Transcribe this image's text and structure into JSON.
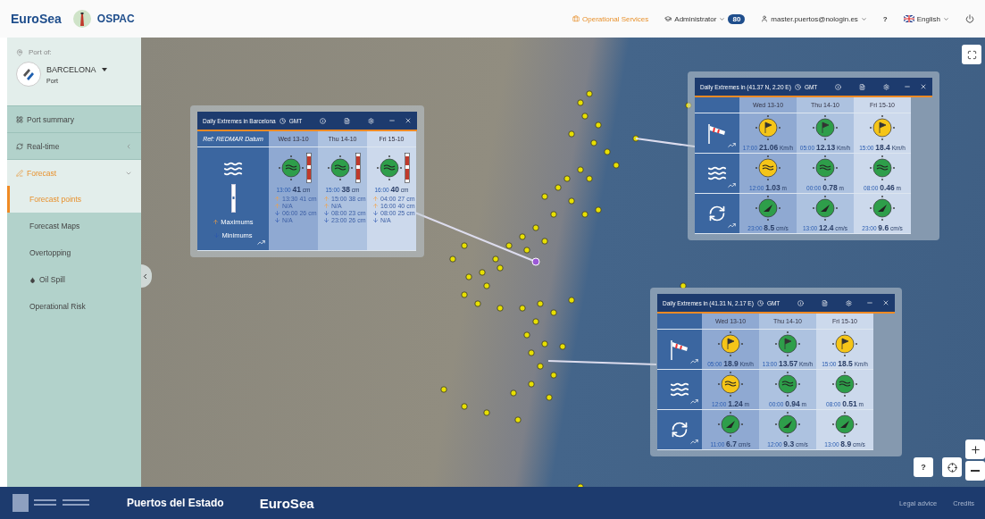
{
  "header": {
    "brand": "EuroSea",
    "logo_title": "OSPAC",
    "nav": [
      {
        "kind": "services",
        "label": "Operational Services"
      },
      {
        "kind": "role",
        "label": "Administrator",
        "badge": "80"
      },
      {
        "kind": "account",
        "label": "master.puertos@nologin.es"
      },
      {
        "kind": "help",
        "label": "?"
      },
      {
        "kind": "language",
        "label": "English"
      },
      {
        "kind": "logout"
      }
    ]
  },
  "sidebar": {
    "port_label": "Port of:",
    "port_name": "BARCELONA",
    "port_type": "Port",
    "items": [
      {
        "kind": "link",
        "label": "Port summary",
        "selected": false
      },
      {
        "kind": "group",
        "label": "Real-time",
        "selected": false,
        "expanded": false
      },
      {
        "kind": "group",
        "label": "Forecast",
        "selected": true,
        "expanded": true,
        "children": [
          {
            "label": "Forecast points",
            "selected": true
          },
          {
            "label": "Forecast Maps",
            "selected": false
          },
          {
            "label": "Overtopping",
            "selected": false
          },
          {
            "label": "Oil Spill",
            "selected": false
          },
          {
            "label": "Operational Risk",
            "selected": false
          }
        ]
      }
    ]
  },
  "map": {
    "help_label": "?"
  },
  "popups": [
    {
      "title": "Daily Extremes in Barcelona",
      "timezone": "GMT",
      "ref": "Ref: REDMAR Datum",
      "days": [
        "Wed 13-10",
        "Thu 14-10",
        "Fri 15-10"
      ],
      "rows": [
        {
          "kind": "sea_level",
          "legend": [
            "Maximums",
            "Minimums"
          ],
          "cells": [
            {
              "time": "13:00",
              "value": "41",
              "unit": "cm",
              "color": "#2e9e4a",
              "extremes": [
                {
                  "kind": "max",
                  "text": "13:30 41 cm"
                },
                {
                  "kind": "max",
                  "text": "N/A"
                },
                {
                  "kind": "min",
                  "text": "06:00 26 cm"
                },
                {
                  "kind": "min",
                  "text": "N/A"
                }
              ]
            },
            {
              "time": "15:00",
              "value": "38",
              "unit": "cm",
              "color": "#2e9e4a",
              "extremes": [
                {
                  "kind": "max",
                  "text": "15:00 38 cm"
                },
                {
                  "kind": "max",
                  "text": "N/A"
                },
                {
                  "kind": "min",
                  "text": "08:00 23 cm"
                },
                {
                  "kind": "min",
                  "text": "23:00 26 cm"
                }
              ]
            },
            {
              "time": "16:00",
              "value": "40",
              "unit": "cm",
              "color": "#2e9e4a",
              "extremes": [
                {
                  "kind": "max",
                  "text": "04:00 27 cm"
                },
                {
                  "kind": "max",
                  "text": "16:00 40 cm"
                },
                {
                  "kind": "min",
                  "text": "08:00 25 cm"
                },
                {
                  "kind": "min",
                  "text": "N/A"
                }
              ]
            }
          ]
        }
      ]
    },
    {
      "title": "Daily Extremes in (41.37 N, 2.20 E)",
      "timezone": "GMT",
      "days": [
        "Wed 13-10",
        "Thu 14-10",
        "Fri 15-10"
      ],
      "rows": [
        {
          "kind": "wind",
          "cells": [
            {
              "time": "17:00",
              "value": "21.06",
              "unit": "Km/h",
              "color": "#f5c518"
            },
            {
              "time": "05:00",
              "value": "12.13",
              "unit": "Km/h",
              "color": "#2e9e4a"
            },
            {
              "time": "15:00",
              "value": "18.4",
              "unit": "Km/h",
              "color": "#f5c518"
            }
          ]
        },
        {
          "kind": "waves",
          "cells": [
            {
              "time": "12:00",
              "value": "1.03",
              "unit": "m",
              "color": "#f5c518"
            },
            {
              "time": "00:00",
              "value": "0.78",
              "unit": "m",
              "color": "#2e9e4a"
            },
            {
              "time": "08:00",
              "value": "0.46",
              "unit": "m",
              "color": "#2e9e4a"
            }
          ]
        },
        {
          "kind": "current",
          "cells": [
            {
              "time": "23:00",
              "value": "8.5",
              "unit": "cm/s",
              "color": "#2e9e4a"
            },
            {
              "time": "13:00",
              "value": "12.4",
              "unit": "cm/s",
              "color": "#2e9e4a"
            },
            {
              "time": "23:00",
              "value": "9.6",
              "unit": "cm/s",
              "color": "#2e9e4a"
            }
          ]
        }
      ]
    },
    {
      "title": "Daily Extremes in (41.31 N, 2.17 E)",
      "timezone": "GMT",
      "days": [
        "Wed 13-10",
        "Thu 14-10",
        "Fri 15-10"
      ],
      "rows": [
        {
          "kind": "wind",
          "cells": [
            {
              "time": "05:00",
              "value": "18.9",
              "unit": "Km/h",
              "color": "#f5c518"
            },
            {
              "time": "13:00",
              "value": "13.57",
              "unit": "Km/h",
              "color": "#2e9e4a"
            },
            {
              "time": "15:00",
              "value": "18.5",
              "unit": "Km/h",
              "color": "#f5c518"
            }
          ]
        },
        {
          "kind": "waves",
          "cells": [
            {
              "time": "12:00",
              "value": "1.24",
              "unit": "m",
              "color": "#f5c518"
            },
            {
              "time": "00:00",
              "value": "0.94",
              "unit": "m",
              "color": "#2e9e4a"
            },
            {
              "time": "08:00",
              "value": "0.51",
              "unit": "m",
              "color": "#2e9e4a"
            }
          ]
        },
        {
          "kind": "current",
          "cells": [
            {
              "time": "11:00",
              "value": "6.7",
              "unit": "cm/s",
              "color": "#2e9e4a"
            },
            {
              "time": "12:00",
              "value": "9.3",
              "unit": "cm/s",
              "color": "#2e9e4a"
            },
            {
              "time": "13:00",
              "value": "8.9",
              "unit": "cm/s",
              "color": "#2e9e4a"
            }
          ]
        }
      ]
    }
  ],
  "footer": {
    "brands": [
      "Puertos del Estado",
      "EuroSea"
    ],
    "links": [
      "Legal advice",
      "Credits"
    ]
  }
}
